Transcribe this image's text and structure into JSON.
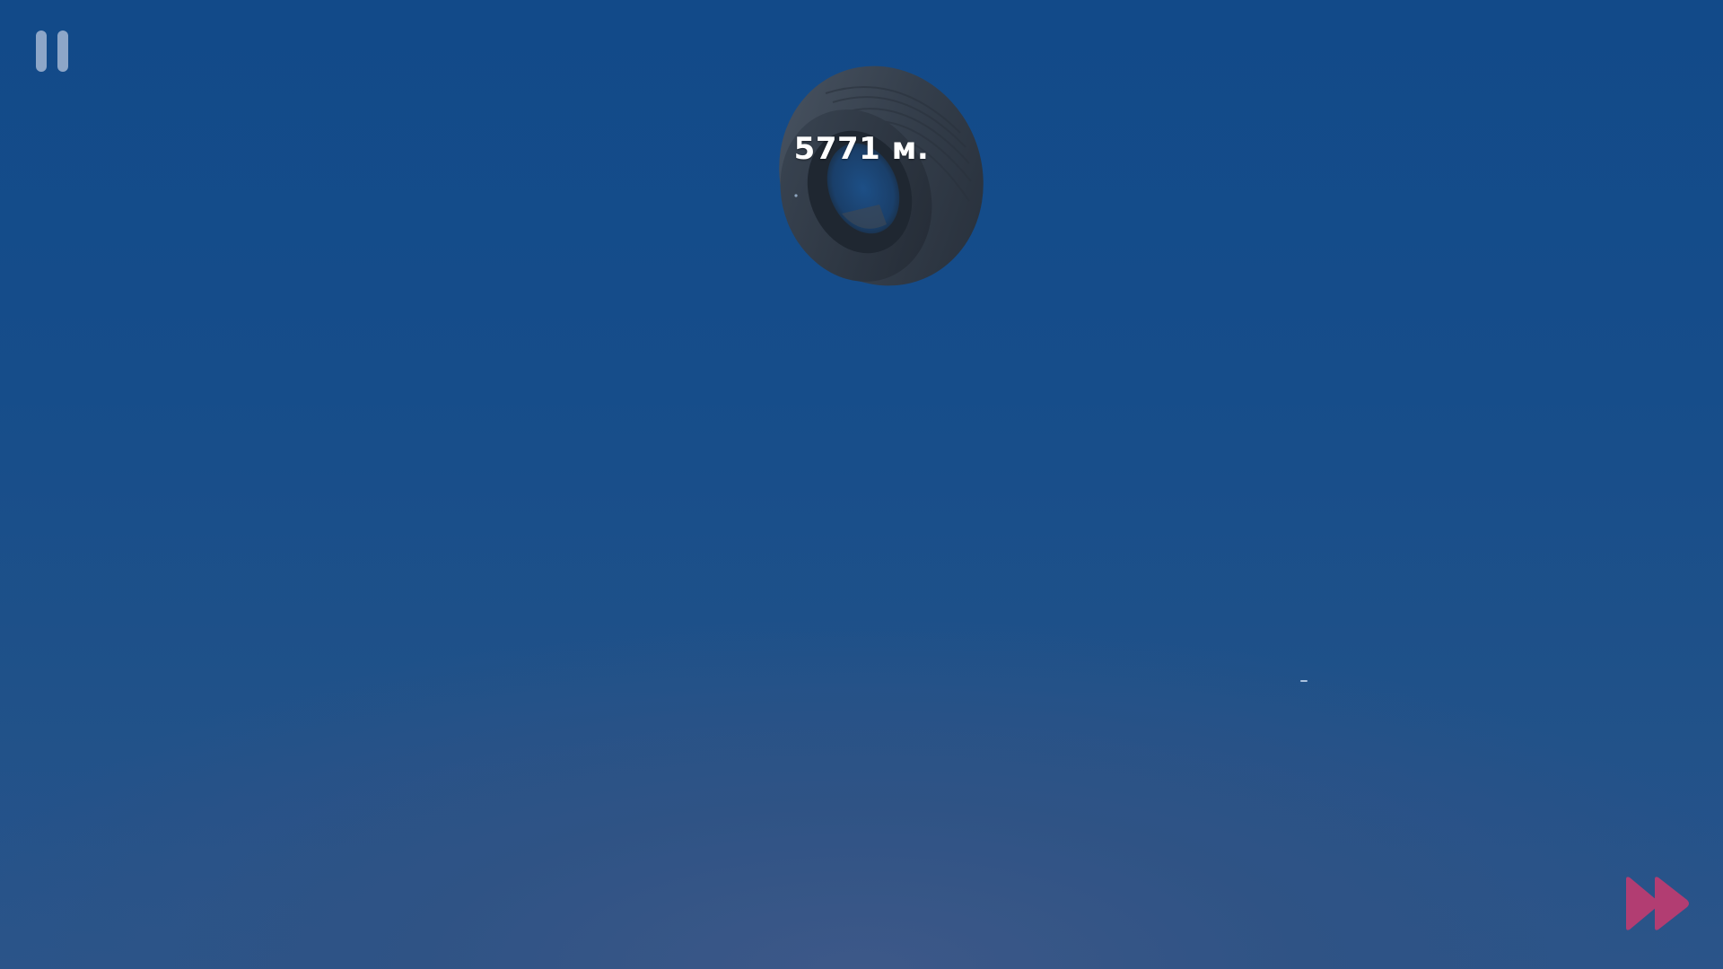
{
  "hud": {
    "distance_text": "5771 м."
  },
  "controls": {
    "pause_icon": "pause-icon",
    "fast_forward_icon": "fast-forward-icon"
  },
  "colors": {
    "sky_top": "#124a89",
    "sky_bottom": "#3d5888",
    "pause": "#a3b6d3",
    "fast_forward": "#b23d72",
    "distance_text": "#ffffff"
  }
}
